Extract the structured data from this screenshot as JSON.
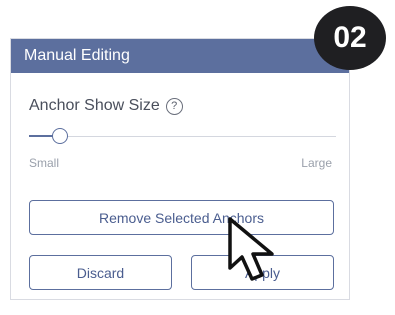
{
  "step_badge": "02",
  "panel": {
    "title": "Manual Editing",
    "anchor_size_label": "Anchor Show Size",
    "help_icon_glyph": "?",
    "slider": {
      "min_label": "Small",
      "max_label": "Large",
      "value": 0.1
    },
    "buttons": {
      "remove": "Remove Selected Anchors",
      "discard": "Discard",
      "apply": "Apply"
    }
  },
  "colors": {
    "accent": "#5c6f9e",
    "badge_bg": "#1f1f22"
  },
  "icons": {
    "help": "question-circle-icon",
    "cursor": "arrow-pointer-icon"
  }
}
